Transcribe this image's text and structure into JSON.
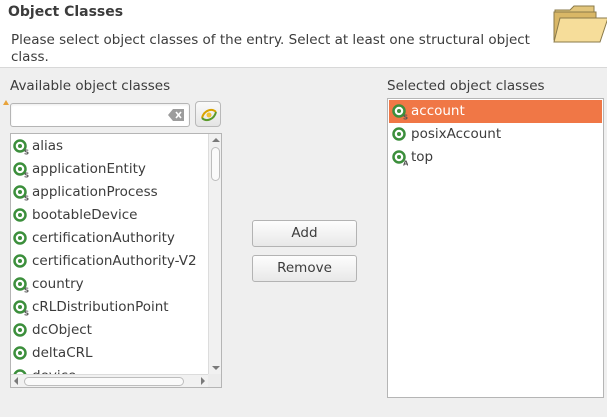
{
  "header": {
    "title": "Object Classes",
    "description": "Please select object classes of the entry. Select at least one structural object class."
  },
  "available": {
    "label": "Available object classes",
    "filter_value": "",
    "items": [
      {
        "label": "alias",
        "kind": "structural"
      },
      {
        "label": "applicationEntity",
        "kind": "structural"
      },
      {
        "label": "applicationProcess",
        "kind": "structural"
      },
      {
        "label": "bootableDevice",
        "kind": "auxiliary"
      },
      {
        "label": "certificationAuthority",
        "kind": "auxiliary"
      },
      {
        "label": "certificationAuthority-V2",
        "kind": "auxiliary"
      },
      {
        "label": "country",
        "kind": "structural"
      },
      {
        "label": "cRLDistributionPoint",
        "kind": "structural"
      },
      {
        "label": "dcObject",
        "kind": "auxiliary"
      },
      {
        "label": "deltaCRL",
        "kind": "auxiliary"
      },
      {
        "label": "device",
        "kind": "structural"
      }
    ]
  },
  "actions": {
    "add_label": "Add",
    "remove_label": "Remove"
  },
  "selected": {
    "label": "Selected object classes",
    "items": [
      {
        "label": "account",
        "kind": "structural",
        "selected": true
      },
      {
        "label": "posixAccount",
        "kind": "auxiliary",
        "selected": false
      },
      {
        "label": "top",
        "kind": "abstract",
        "selected": false
      }
    ]
  },
  "colors": {
    "selection": "#f07746",
    "icon_green": "#3c8f3c"
  }
}
